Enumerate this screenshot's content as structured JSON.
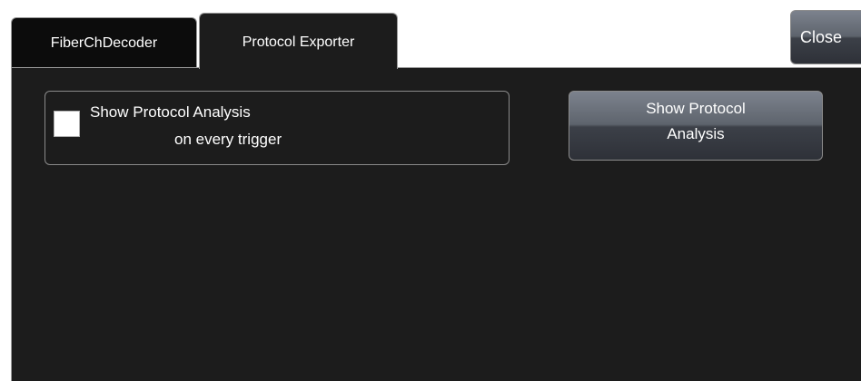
{
  "tabs": [
    {
      "label": "FiberChDecoder",
      "active": false
    },
    {
      "label": "Protocol Exporter",
      "active": true
    }
  ],
  "close_button": {
    "label": "Close"
  },
  "trigger_option": {
    "label_line1": "Show Protocol Analysis",
    "label_line2": "on every trigger",
    "checked": false
  },
  "show_button": {
    "label_line1": "Show Protocol",
    "label_line2": "Analysis"
  },
  "colors": {
    "panel_background": "#1c1c1c",
    "inactive_tab_background": "#0c0c0c",
    "button_top": "#7c828d",
    "button_bottom": "#2e3138",
    "text": "#ffffff"
  }
}
